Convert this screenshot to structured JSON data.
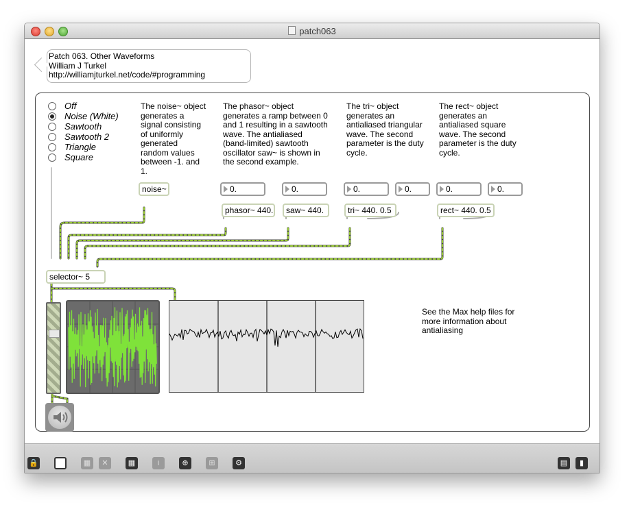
{
  "window": {
    "title": "patch063"
  },
  "header_comment": {
    "line1": "Patch 063. Other Waveforms",
    "line2": "William J Turkel",
    "line3": "http://williamjturkel.net/code/#programming"
  },
  "radio_options": [
    {
      "label": "Off",
      "selected": false
    },
    {
      "label": "Noise (White)",
      "selected": true
    },
    {
      "label": "Sawtooth",
      "selected": false
    },
    {
      "label": "Sawtooth 2",
      "selected": false
    },
    {
      "label": "Triangle",
      "selected": false
    },
    {
      "label": "Square",
      "selected": false
    }
  ],
  "descriptions": {
    "noise": [
      "The noise~ object",
      "generates a",
      "signal consisting",
      "of uniformly",
      "generated",
      "random values",
      "between -1. and",
      "1."
    ],
    "phasor": [
      "The phasor~ object",
      "generates a ramp between 0",
      "and 1 resulting in a sawtooth",
      "wave. The antialiased",
      "(band-limited)  sawtooth",
      "oscillator saw~ is shown in",
      "the second example."
    ],
    "tri": [
      "The tri~ object",
      "generates an",
      "antialiased triangular",
      "wave. The second",
      "parameter is the duty",
      "cycle."
    ],
    "rect": [
      "The rect~ object",
      "generates an",
      "antialiased square",
      "wave. The second",
      "parameter is the duty",
      "cycle."
    ],
    "help": [
      "See the Max help files for",
      "more information about",
      "antialiasing"
    ]
  },
  "objects": {
    "noise": "noise~",
    "phasor": "phasor~ 440.",
    "saw": "saw~ 440.",
    "tri": "tri~ 440. 0.5",
    "rect": "rect~ 440. 0.5",
    "selector": "selector~ 5"
  },
  "number_boxes": {
    "phasor_freq": "0.",
    "saw_freq": "0.",
    "tri_freq": "0.",
    "tri_duty": "0.",
    "rect_freq": "0.",
    "rect_duty": "0."
  },
  "colors": {
    "patch_cord_signal": "#9acd32",
    "meter_wave": "#7fe23a",
    "object_border": "#c9d3b5"
  },
  "toolbar": {
    "buttons": [
      "lock-icon",
      "presentation-icon",
      "new-object-icon",
      "delete-icon",
      "inspector-icon",
      "info-icon",
      "slider-icon",
      "grid-icon",
      "audio-dsp-icon",
      "split-view-icon",
      "sidebar-icon"
    ]
  }
}
